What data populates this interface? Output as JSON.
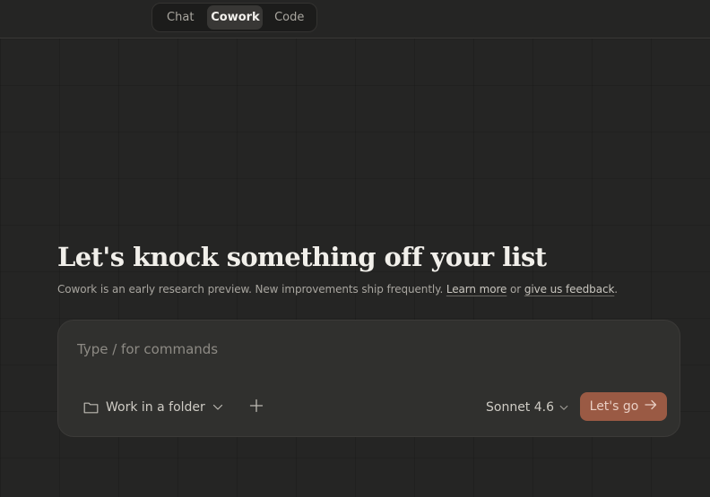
{
  "modes": {
    "tabs": [
      "Chat",
      "Cowork",
      "Code"
    ],
    "active": "Cowork"
  },
  "hero": {
    "title": "Let's knock something off your list",
    "subtitle_prefix": "Cowork is an early research preview. New improvements ship frequently. ",
    "learn_more": "Learn more",
    "or": " or ",
    "feedback": "give us feedback",
    "period": "."
  },
  "composer": {
    "placeholder": "Type / for commands",
    "value": "",
    "folder_label": "Work in a folder",
    "model": "Sonnet 4.6",
    "submit_label": "Let's go"
  },
  "icons": {
    "folder": "folder-icon",
    "chevron": "chevron-down-icon",
    "plus": "plus-icon",
    "arrow": "arrow-right-icon"
  },
  "colors": {
    "background": "#252524",
    "card": "#30302e",
    "accent": "#9a5a44"
  }
}
